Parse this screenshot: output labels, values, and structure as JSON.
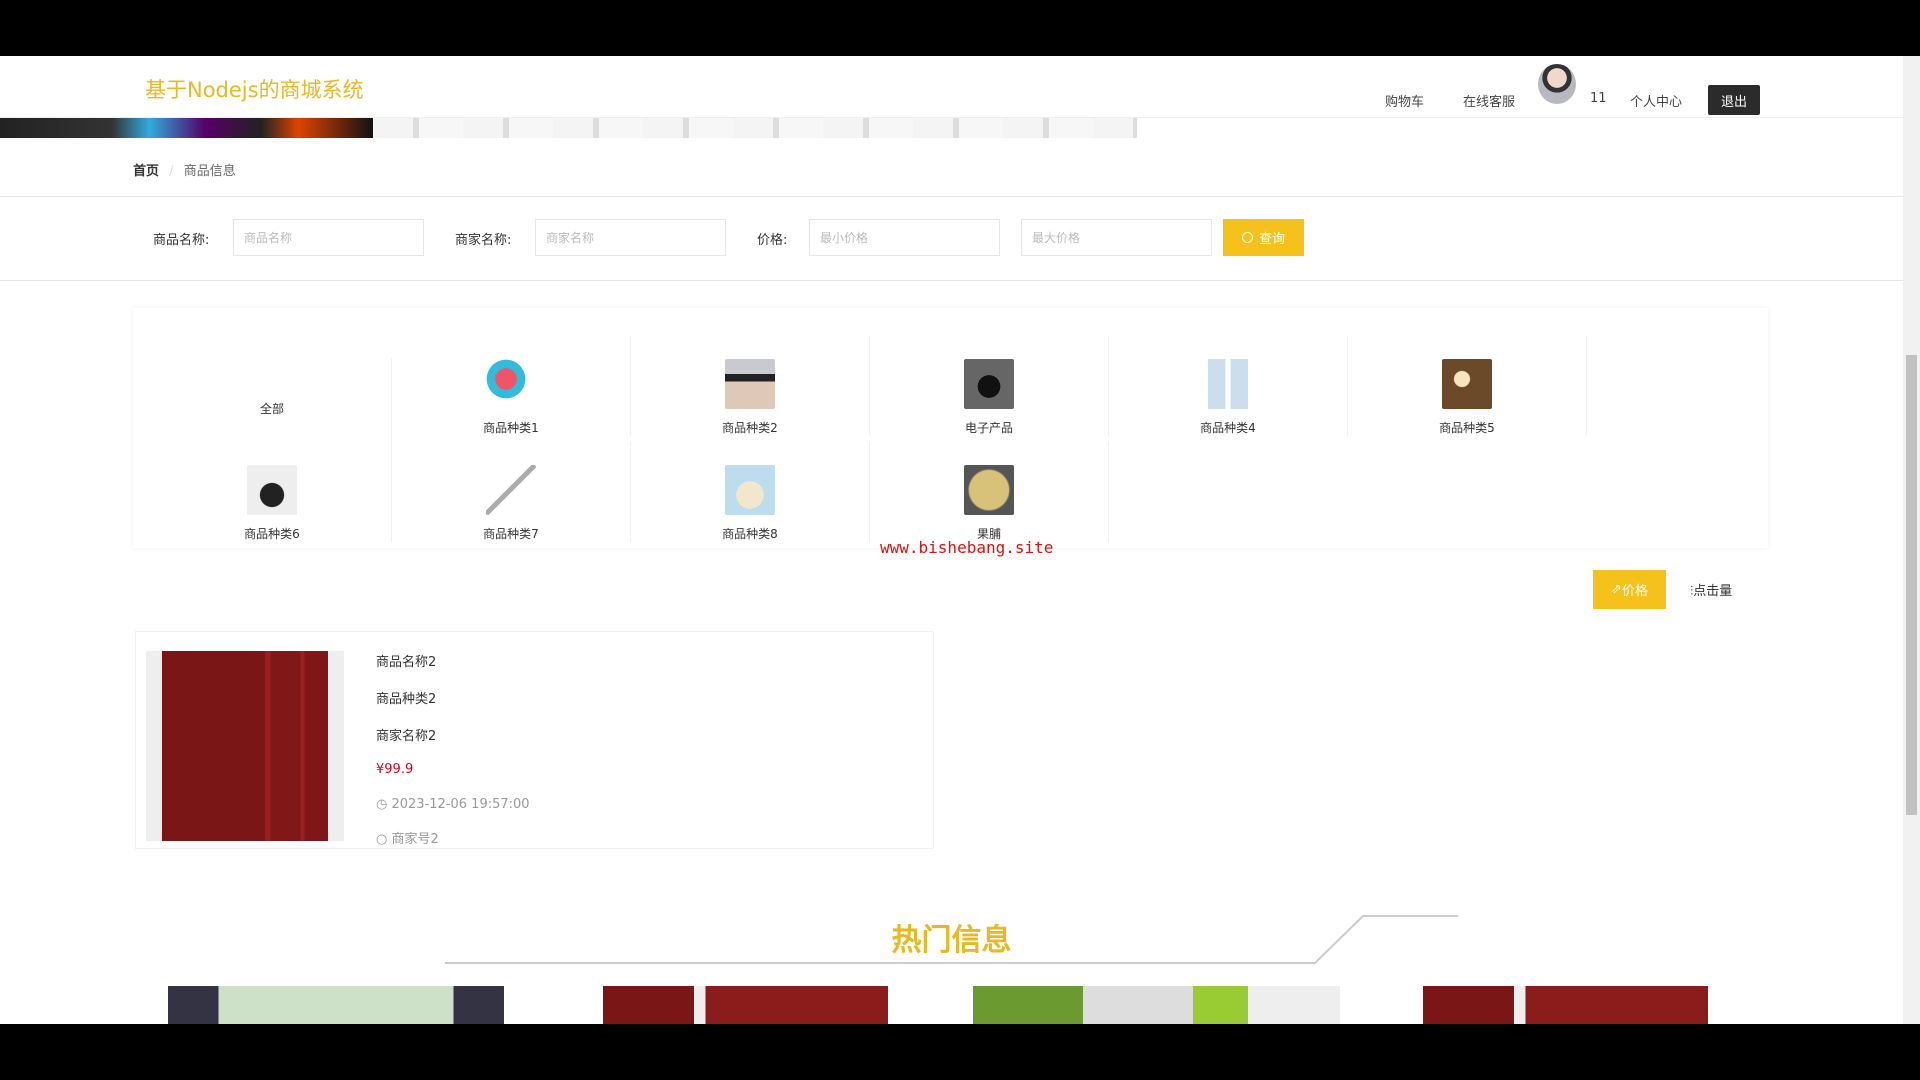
{
  "header": {
    "title": "基于Nodejs的商城系统",
    "nav": [
      "购物车",
      "在线客服"
    ],
    "count": "11",
    "profile": "个人中心",
    "logout": "退出"
  },
  "breadcrumb": {
    "home": "首页",
    "separator": "/",
    "current": "商品信息"
  },
  "search": {
    "name_label": "商品名称:",
    "name_placeholder": "商品名称",
    "merchant_label": "商家名称:",
    "merchant_placeholder": "商家名称",
    "price_label": "价格:",
    "min_placeholder": "最小价格",
    "max_placeholder": "最大价格",
    "button": "查询"
  },
  "categories": [
    "全部",
    "商品种类1",
    "商品种类2",
    "电子产品",
    "商品种类4",
    "商品种类5",
    "商品种类6",
    "商品种类7",
    "商品种类8",
    "果脯"
  ],
  "watermark": "www.bishebang.site",
  "sort": {
    "price": "价格",
    "clicks": "点击量"
  },
  "product": {
    "name": "商品名称2",
    "category": "商品种类2",
    "merchant": "商家名称2",
    "price": "¥99.9",
    "time": "2023-12-06 19:57:00",
    "extra": "商家号2"
  },
  "hot": {
    "title": "热门信息"
  }
}
